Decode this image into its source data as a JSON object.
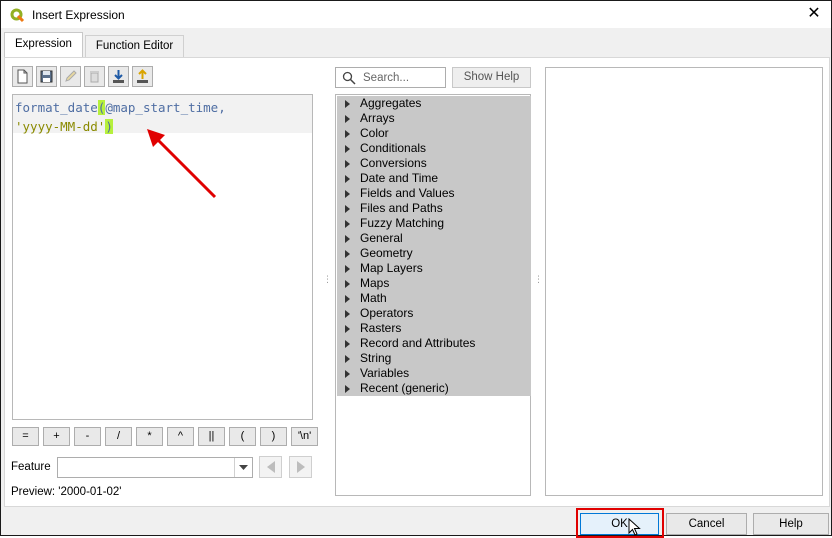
{
  "window": {
    "title": "Insert Expression",
    "close_glyph": "✕"
  },
  "tabs": [
    {
      "label": "Expression",
      "active": true
    },
    {
      "label": "Function Editor",
      "active": false
    }
  ],
  "toolbar": {
    "icons": [
      "new-file-icon",
      "save-icon",
      "edit-icon",
      "delete-icon",
      "import-icon",
      "export-icon"
    ]
  },
  "editor": {
    "line1": {
      "fn": "format_date",
      "open_paren": "(",
      "var": "@map_start_time,",
      "full": "format_date(@map_start_time,"
    },
    "line2": {
      "str": "'yyyy-MM-dd'",
      "close_paren": ")"
    }
  },
  "operators": [
    "=",
    "+",
    "-",
    "/",
    "*",
    "^",
    "||",
    "(",
    ")",
    "'\\n'"
  ],
  "feature": {
    "label": "Feature",
    "value": ""
  },
  "preview": {
    "text": "Preview:  '2000-01-02'"
  },
  "search": {
    "placeholder": "Search..."
  },
  "show_help": {
    "label": "Show Help"
  },
  "function_groups": [
    "Aggregates",
    "Arrays",
    "Color",
    "Conditionals",
    "Conversions",
    "Date and Time",
    "Fields and Values",
    "Files and Paths",
    "Fuzzy Matching",
    "General",
    "Geometry",
    "Map Layers",
    "Maps",
    "Math",
    "Operators",
    "Rasters",
    "Record and Attributes",
    "String",
    "Variables",
    "Recent (generic)"
  ],
  "buttons": {
    "ok": "OK",
    "cancel": "Cancel",
    "help": "Help"
  },
  "colors": {
    "annotation_red": "#e00000",
    "highlight_green": "#b6f03c",
    "tree_selection": "#c8c8c8"
  }
}
